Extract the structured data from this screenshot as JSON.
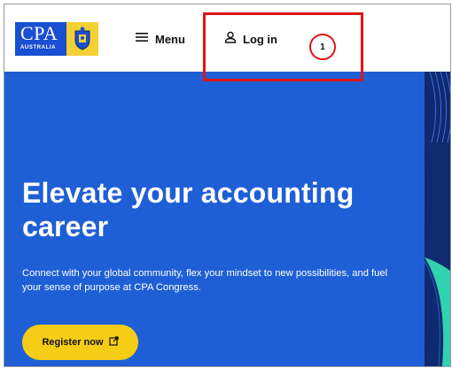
{
  "header": {
    "logo": {
      "text": "CPA",
      "subtext": "AUSTRALIA",
      "crest_icon": "crest-icon"
    },
    "menu": {
      "label": "Menu",
      "icon": "hamburger-icon"
    },
    "login": {
      "label": "Log in",
      "icon": "user-icon"
    }
  },
  "annotation": {
    "step_number": "1",
    "color": "#e01515"
  },
  "hero": {
    "title": "Elevate your accounting career",
    "subtitle": "Connect with your global community, flex your mindset to new possibilities, and fuel your sense of purpose at CPA Congress.",
    "cta": {
      "label": "Register now",
      "icon": "external-link-icon"
    }
  },
  "colors": {
    "brand_blue": "#1f5fd6",
    "logo_blue": "#1a4fd1",
    "logo_yellow": "#f3d033",
    "cta_yellow": "#f5cc16",
    "accent_teal": "#2fd3b0",
    "deco_navy": "#0f2a6e"
  }
}
